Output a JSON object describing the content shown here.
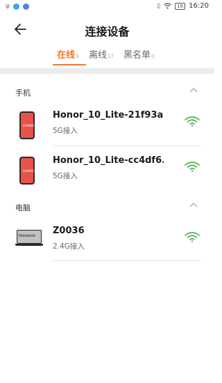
{
  "statusbar": {
    "time": "16:20",
    "battery": "16"
  },
  "header": {
    "title": "连接设备"
  },
  "tabs": [
    {
      "label": "在线",
      "count": "3",
      "active": true
    },
    {
      "label": "离线",
      "count": "17",
      "active": false
    },
    {
      "label": "黑名单",
      "count": "0",
      "active": false
    }
  ],
  "sections": [
    {
      "label": "手机",
      "devices": [
        {
          "name": "Honor_10_Lite-21f93a...",
          "conn": "5G接入",
          "brand": "HUAWEI"
        },
        {
          "name": "Honor_10_Lite-cc4df6...",
          "conn": "5G接入",
          "brand": "HUAWEI"
        }
      ]
    },
    {
      "label": "电脑",
      "devices": [
        {
          "name": "Z0036",
          "conn": "2.4G接入",
          "brand": "Notebook"
        }
      ]
    }
  ],
  "colors": {
    "accent": "#f0782c",
    "wifi": "#4caf50",
    "phone": "#e8524a"
  }
}
